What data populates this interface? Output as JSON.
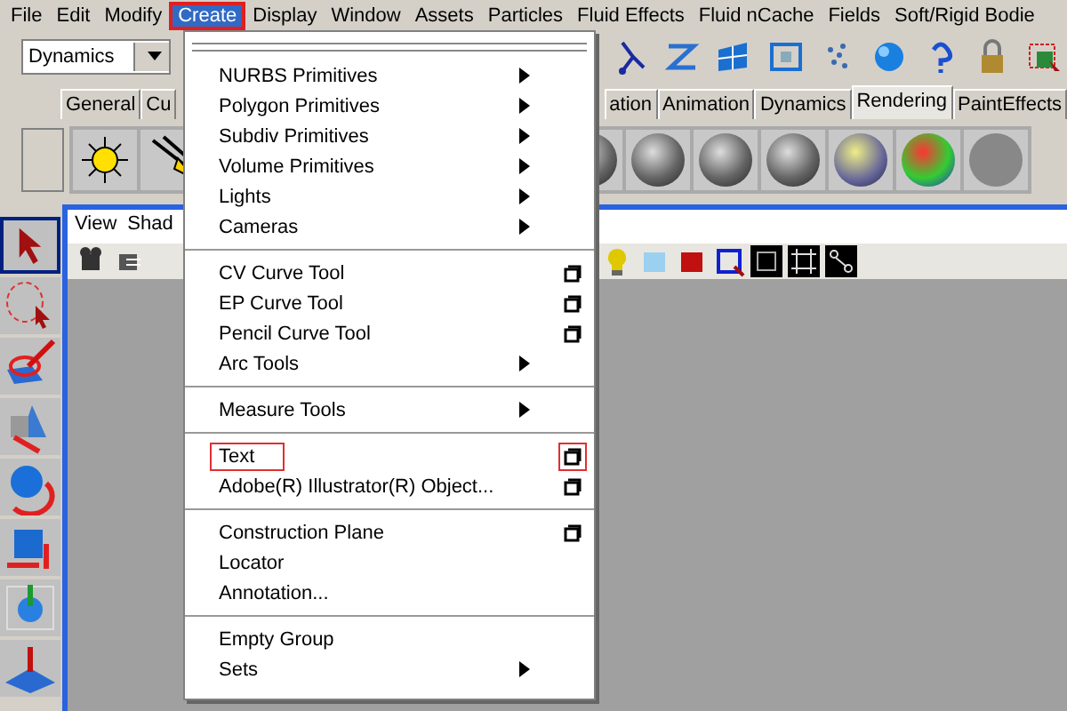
{
  "menu_bar": [
    {
      "label": "File",
      "selected": false
    },
    {
      "label": "Edit",
      "selected": false
    },
    {
      "label": "Modify",
      "selected": false
    },
    {
      "label": "Create",
      "selected": true
    },
    {
      "label": "Display",
      "selected": false
    },
    {
      "label": "Window",
      "selected": false
    },
    {
      "label": "Assets",
      "selected": false
    },
    {
      "label": "Particles",
      "selected": false
    },
    {
      "label": "Fluid Effects",
      "selected": false
    },
    {
      "label": "Fluid nCache",
      "selected": false
    },
    {
      "label": "Fields",
      "selected": false
    },
    {
      "label": "Soft/Rigid Bodie",
      "selected": false
    }
  ],
  "mode_selector": {
    "value": "Dynamics"
  },
  "shelf_tabs": [
    {
      "label": "General",
      "selected": false
    },
    {
      "label": "Cu",
      "selected": false
    },
    {
      "label": "ation",
      "selected": false
    },
    {
      "label": "Animation",
      "selected": false
    },
    {
      "label": "Dynamics",
      "selected": false
    },
    {
      "label": "Rendering",
      "selected": true
    },
    {
      "label": "PaintEffects",
      "selected": false
    }
  ],
  "panel_menu": [
    "View",
    "Shad"
  ],
  "create_menu": {
    "items": [
      {
        "kind": "submenu",
        "label": "NURBS Primitives",
        "marked": false
      },
      {
        "kind": "submenu",
        "label": "Polygon Primitives",
        "marked": false
      },
      {
        "kind": "submenu",
        "label": "Subdiv Primitives",
        "marked": false
      },
      {
        "kind": "submenu",
        "label": "Volume Primitives",
        "marked": false
      },
      {
        "kind": "submenu",
        "label": "Lights",
        "marked": false
      },
      {
        "kind": "submenu",
        "label": "Cameras",
        "marked": false
      },
      {
        "kind": "separator"
      },
      {
        "kind": "option",
        "label": "CV Curve Tool",
        "marked": false,
        "option_marked": false
      },
      {
        "kind": "option",
        "label": "EP Curve Tool",
        "marked": false,
        "option_marked": false
      },
      {
        "kind": "option",
        "label": "Pencil Curve Tool",
        "marked": false,
        "option_marked": false
      },
      {
        "kind": "submenu",
        "label": "Arc Tools",
        "marked": false
      },
      {
        "kind": "separator"
      },
      {
        "kind": "submenu",
        "label": "Measure Tools",
        "marked": false
      },
      {
        "kind": "separator"
      },
      {
        "kind": "option",
        "label": "Text",
        "marked": true,
        "option_marked": true
      },
      {
        "kind": "option",
        "label": "Adobe(R) Illustrator(R) Object...",
        "marked": false,
        "option_marked": false
      },
      {
        "kind": "separator"
      },
      {
        "kind": "option",
        "label": "Construction Plane",
        "marked": false,
        "option_marked": false
      },
      {
        "kind": "plain",
        "label": "Locator",
        "marked": false
      },
      {
        "kind": "plain",
        "label": "Annotation...",
        "marked": false
      },
      {
        "kind": "separator"
      },
      {
        "kind": "plain",
        "label": "Empty Group",
        "marked": false
      },
      {
        "kind": "submenu",
        "label": "Sets",
        "marked": false
      }
    ]
  }
}
